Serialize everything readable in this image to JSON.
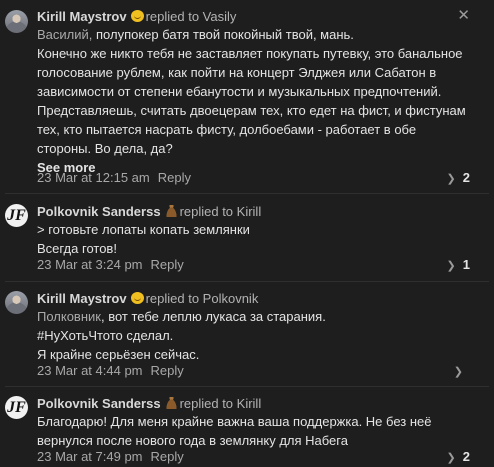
{
  "comments": [
    {
      "author": "Kirill Maystrov",
      "avatar_icon": "user-photo",
      "author_emoji": "smile-emoji",
      "replied_to": "replied to Vasily",
      "mention": "Василий,",
      "lines": [
        " полупокер батя твой покойный твой, мань.",
        "Конечно же никто тебя не заставляет покупать путевку, это банальное",
        "голосование рублем, как пойти на концерт Элджея или Сабатон в",
        "зависимости от степени ебанутости и музыкальных предпочтений.",
        "Представляешь, считать двоецерам тех, кто едет на фист, и фистунам",
        "тех, кто пытается насрать фисту, долбоебами - работает в обе",
        "стороны. Во дела, да?"
      ],
      "see_more": "See more",
      "date": "23 Mar at 12:15 am",
      "reply": "Reply",
      "likes": "2"
    },
    {
      "author": "Polkovnik Sanderss",
      "avatar_icon": "logo-jf",
      "avatar_text": "JF",
      "author_emoji": "poo-emoji",
      "replied_to": "replied to Kirill",
      "lines": [
        "> готовьте лопаты копать землянки",
        "Всегда готов!"
      ],
      "date": "23 Mar at 3:24 pm",
      "reply": "Reply",
      "likes": "1"
    },
    {
      "author": "Kirill Maystrov",
      "avatar_icon": "user-photo",
      "author_emoji": "smile-emoji",
      "replied_to": "replied to Polkovnik",
      "mention": "Полковник",
      "lines": [
        ", вот тебе леплю лукаса за старания.",
        "#НуХотьЧтото сделал.",
        "Я крайне серьёзен сейчас."
      ],
      "date": "23 Mar at 4:44 pm",
      "reply": "Reply"
    },
    {
      "author": "Polkovnik Sanderss",
      "avatar_icon": "logo-jf",
      "avatar_text": "JF",
      "author_emoji": "poo-emoji",
      "replied_to": "replied to Kirill",
      "lines": [
        "Благодарю! Для меня крайне важна ваша поддержка. Не без неё",
        "вернулся после нового года в землянку для Набега"
      ],
      "date": "23 Mar at 7:49 pm",
      "reply": "Reply",
      "likes": "2"
    }
  ],
  "close_symbol": "✕",
  "like_chevron": "❯"
}
